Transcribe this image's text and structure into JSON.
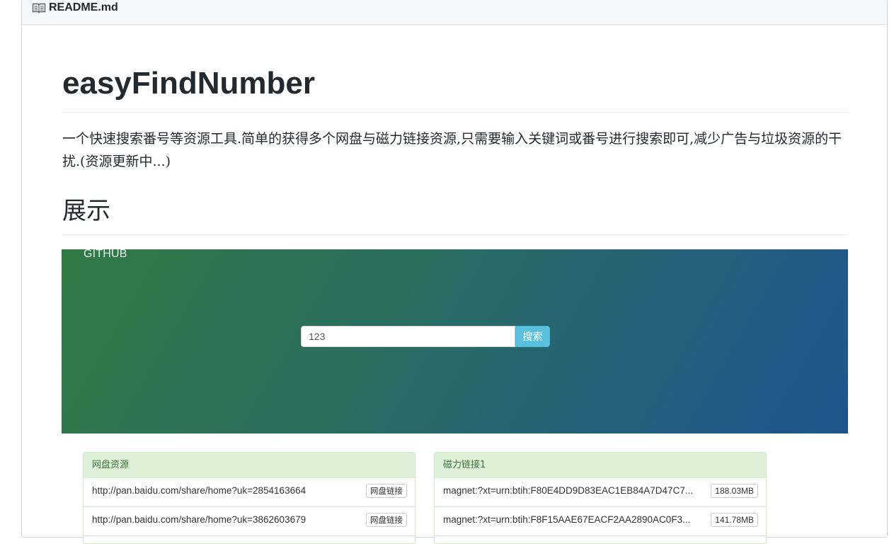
{
  "readme": {
    "filename": "README.md",
    "title": "easyFindNumber",
    "description": "一个快速搜索番号等资源工具.简单的获得多个网盘与磁力链接资源,只需要输入关键词或番号进行搜索即可,减少广告与垃圾资源的干扰.(资源更新中...)",
    "section_heading": "展示"
  },
  "screenshot": {
    "github_link": "GITHUB",
    "search": {
      "value": "123",
      "button_label": "搜索"
    },
    "colors": {
      "banner_start": "#327a45",
      "banner_end": "#1e568c",
      "button": "#5bc0de",
      "panel_heading_bg": "#dff0d8"
    },
    "netdisk_panel": {
      "heading": "网盘资源",
      "rows": [
        {
          "link": "http://pan.baidu.com/share/home?uk=2854163664",
          "tag": "网盘链接"
        },
        {
          "link": "http://pan.baidu.com/share/home?uk=3862603679",
          "tag": "网盘链接"
        }
      ]
    },
    "magnet_panel": {
      "heading": "磁力链接1",
      "rows": [
        {
          "link": "magnet:?xt=urn:btih:F80E4DD9D83EAC1EB84A7D47C7...",
          "size": "188.03MB"
        },
        {
          "link": "magnet:?xt=urn:btih:F8F15AAE67EACF2AA2890AC0F3...",
          "size": "141.78MB"
        }
      ]
    }
  }
}
